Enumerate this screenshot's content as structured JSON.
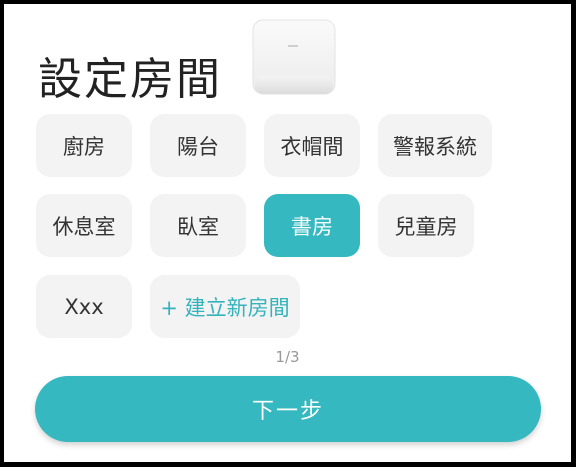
{
  "title": "設定房間",
  "device_image": "hub-device-icon",
  "rooms": [
    {
      "label": "廚房",
      "selected": false
    },
    {
      "label": "陽台",
      "selected": false
    },
    {
      "label": "衣帽間",
      "selected": false
    },
    {
      "label": "警報系統",
      "selected": false
    },
    {
      "label": "休息室",
      "selected": false
    },
    {
      "label": "臥室",
      "selected": false
    },
    {
      "label": "書房",
      "selected": true
    },
    {
      "label": "兒童房",
      "selected": false
    },
    {
      "label": "Xxx",
      "selected": false
    }
  ],
  "add_room_label": "+ 建立新房間",
  "pager": "1/3",
  "next_label": "下一步",
  "colors": {
    "accent": "#35b8c0",
    "chip_bg": "#f3f3f3",
    "text": "#333333"
  }
}
